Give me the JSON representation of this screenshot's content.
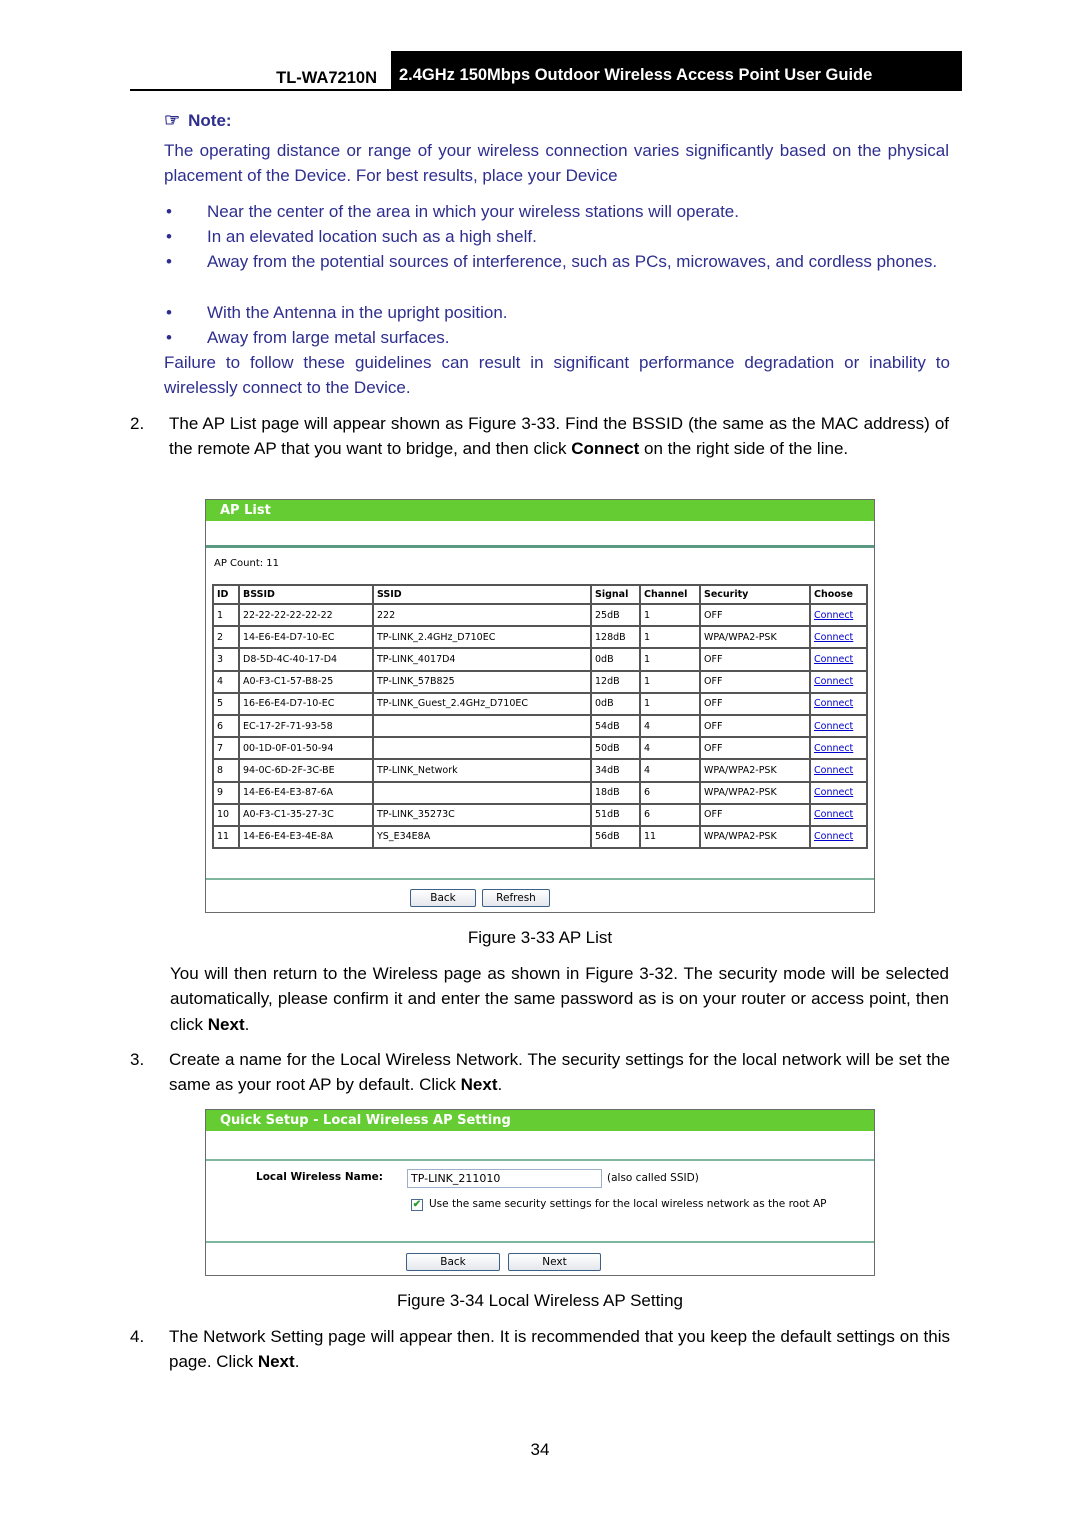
{
  "header": {
    "model": "TL-WA7210N",
    "title": "2.4GHz 150Mbps Outdoor Wireless Access Point User Guide"
  },
  "note": {
    "icon": "pointing-hand-icon",
    "heading": "Note:",
    "intro": "The operating distance or range of your wireless connection varies significantly based on the physical placement of the Device. For best results, place your Device",
    "bullets": [
      "Near the center of the area in which your wireless stations will operate.",
      "In an elevated location such as a high shelf.",
      "Away from the potential sources of interference, such as PCs, microwaves, and cordless phones.",
      "With the Antenna in the upright position.",
      "Away from large metal surfaces."
    ],
    "bullet_glyph": "•",
    "outro": "Failure to follow these guidelines can result in significant performance degradation or inability to wirelessly connect to the Device."
  },
  "steps": {
    "s2": {
      "number": "2.",
      "text_before": "The AP List page will appear shown as Figure 3-33. Find the BSSID (the same as the MAC address) of the remote AP that you want to bridge, and then click ",
      "bold": "Connect",
      "text_after": " on the right side of the line."
    },
    "after_fig33": {
      "text_before": "You will then return to the Wireless page as shown in Figure 3-32. The security mode will be selected automatically, please confirm it and enter the same password as is on your router or access point, then click ",
      "bold": "Next",
      "text_after": "."
    },
    "s3": {
      "number": "3.",
      "text_before": "Create a name for the Local Wireless Network. The security settings for the local network will be set the same as your root AP by default. Click ",
      "bold": "Next",
      "text_after": "."
    },
    "s4": {
      "number": "4.",
      "text_before": "The Network Setting page will appear then. It is recommended that you keep the default settings on this page. Click ",
      "bold": "Next",
      "text_after": "."
    }
  },
  "fig33": {
    "title": "AP List",
    "ap_count_label": "AP Count: 11",
    "columns": [
      "ID",
      "BSSID",
      "SSID",
      "Signal",
      "Channel",
      "Security",
      "Choose"
    ],
    "rows": [
      [
        "1",
        "22-22-22-22-22-22",
        "222",
        "25dB",
        "1",
        "OFF",
        "Connect"
      ],
      [
        "2",
        "14-E6-E4-D7-10-EC",
        "TP-LINK_2.4GHz_D710EC",
        "128dB",
        "1",
        "WPA/WPA2-PSK",
        "Connect"
      ],
      [
        "3",
        "D8-5D-4C-40-17-D4",
        "TP-LINK_4017D4",
        "0dB",
        "1",
        "OFF",
        "Connect"
      ],
      [
        "4",
        "A0-F3-C1-57-B8-25",
        "TP-LINK_57B825",
        "12dB",
        "1",
        "OFF",
        "Connect"
      ],
      [
        "5",
        "16-E6-E4-D7-10-EC",
        "TP-LINK_Guest_2.4GHz_D710EC",
        "0dB",
        "1",
        "OFF",
        "Connect"
      ],
      [
        "6",
        "EC-17-2F-71-93-58",
        "",
        "54dB",
        "4",
        "OFF",
        "Connect"
      ],
      [
        "7",
        "00-1D-0F-01-50-94",
        "",
        "50dB",
        "4",
        "OFF",
        "Connect"
      ],
      [
        "8",
        "94-0C-6D-2F-3C-BE",
        "TP-LINK_Network",
        "34dB",
        "4",
        "WPA/WPA2-PSK",
        "Connect"
      ],
      [
        "9",
        "14-E6-E4-E3-87-6A",
        "",
        "18dB",
        "6",
        "WPA/WPA2-PSK",
        "Connect"
      ],
      [
        "10",
        "A0-F3-C1-35-27-3C",
        "TP-LINK_35273C",
        "51dB",
        "6",
        "OFF",
        "Connect"
      ],
      [
        "11",
        "14-E6-E4-E3-4E-8A",
        "YS_E34E8A",
        "56dB",
        "11",
        "WPA/WPA2-PSK",
        "Connect"
      ]
    ],
    "back_label": "Back",
    "refresh_label": "Refresh",
    "caption": "Figure 3-33 AP List"
  },
  "fig34": {
    "title": "Quick Setup - Local Wireless AP Setting",
    "name_label": "Local Wireless Name:",
    "name_value": "TP-LINK_211010",
    "name_hint": "(also called SSID)",
    "same_security_checked": true,
    "same_security_label": "Use the same security settings for the local wireless network as the root AP",
    "back_label": "Back",
    "next_label": "Next",
    "caption": "Figure 3-34 Local Wireless AP Setting"
  },
  "page_number": "34",
  "colors": {
    "note_text": "#2e2e8f",
    "panel_header": "#66cc33",
    "panel_rule": "#5b9a82",
    "link": "#0000cc"
  }
}
